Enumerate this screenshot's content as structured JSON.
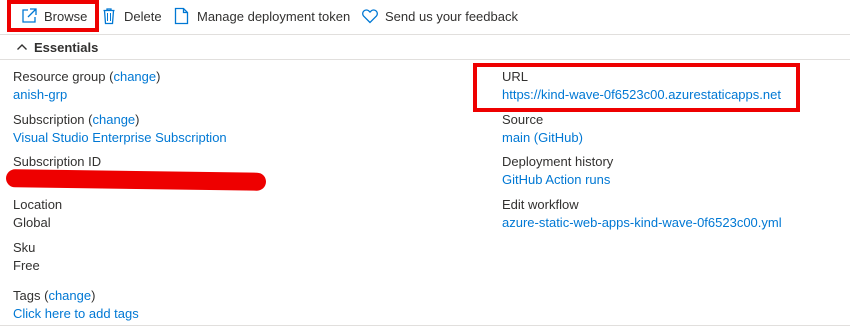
{
  "toolbar": {
    "browse_label": "Browse",
    "delete_label": "Delete",
    "manage_token_label": "Manage deployment token",
    "feedback_label": "Send us your feedback"
  },
  "essentials": {
    "header_label": "Essentials",
    "resource_group_label": "Resource group",
    "change_text": "change",
    "resource_group_value": "anish-grp",
    "subscription_label": "Subscription",
    "subscription_value": "Visual Studio Enterprise Subscription",
    "subscription_id_label": "Subscription ID",
    "location_label": "Location",
    "location_value": "Global",
    "sku_label": "Sku",
    "sku_value": "Free",
    "tags_label": "Tags",
    "tags_value": "Click here to add tags",
    "url_label": "URL",
    "url_value": "https://kind-wave-0f6523c00.azurestaticapps.net",
    "source_label": "Source",
    "source_value": "main (GitHub)",
    "deployment_history_label": "Deployment history",
    "deployment_history_value": "GitHub Action runs",
    "edit_workflow_label": "Edit workflow",
    "edit_workflow_value": "azure-static-web-apps-kind-wave-0f6523c00.yml"
  },
  "colors": {
    "link": "#0078d4",
    "text": "#323130",
    "highlight": "#ee0000"
  },
  "icons": {
    "browse": "external-link-icon",
    "delete": "trash-icon",
    "manage_token": "document-icon",
    "feedback": "heart-icon",
    "essentials": "chevron-up-icon"
  }
}
